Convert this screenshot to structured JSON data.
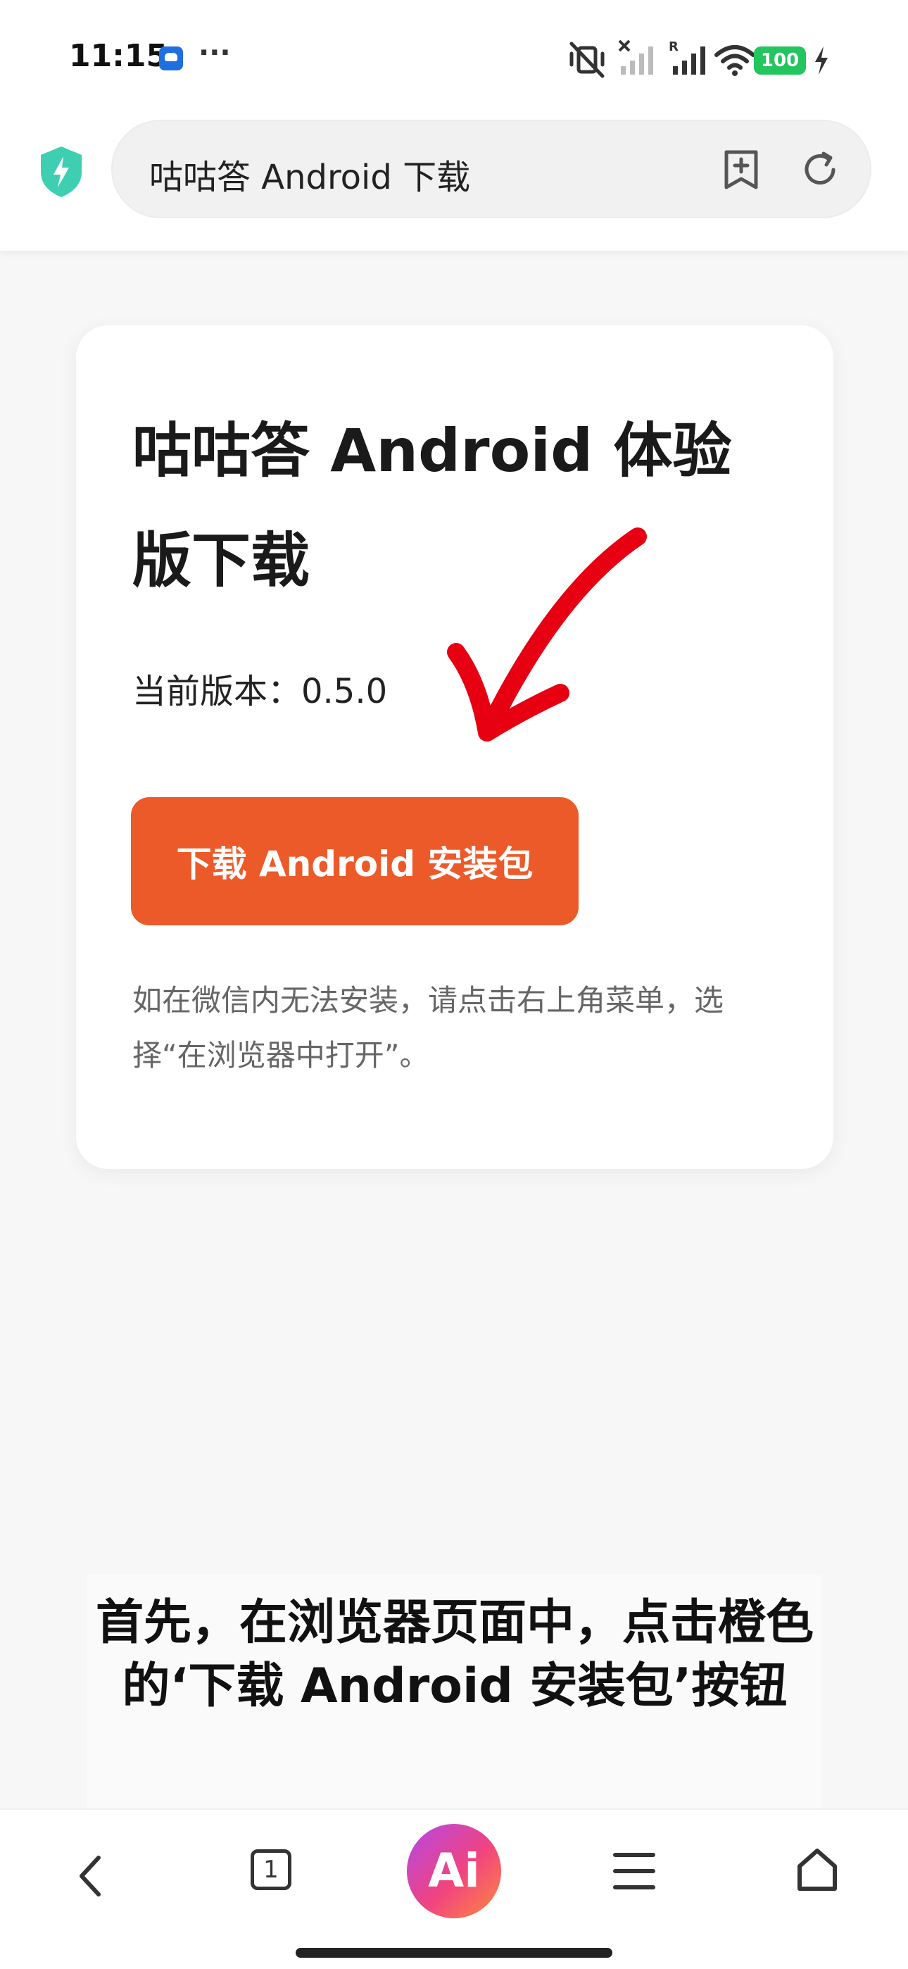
{
  "status_bar": {
    "time": "11:15",
    "more_indicator": "···",
    "battery_level": "100",
    "icons": [
      "app-notification-icon",
      "vibrate-off-icon",
      "signal-no-sim-icon",
      "signal-roaming-icon",
      "wifi-icon",
      "charging-bolt-icon"
    ]
  },
  "browser": {
    "address_text": "咕咕答 Android 下载",
    "icons": [
      "shield-lightning-icon",
      "add-bookmark-icon",
      "reload-icon"
    ],
    "colors": {
      "shield": "#3ecfb2"
    }
  },
  "card": {
    "title": "咕咕答 Android 体验版下载",
    "version_label": "当前版本：0.5.0",
    "download_button": "下载 Android 安装包",
    "note": "如在微信内无法安装，请点击右上角菜单，选择“在浏览器中打开”。",
    "colors": {
      "button": "#ed5a29",
      "annotation_arrow": "#e60012"
    }
  },
  "caption": {
    "text": "首先，在浏览器页面中，点击橙色的‘下载 Android 安装包’按钮"
  },
  "bottom_nav": {
    "tabs_count": "1",
    "ai_label": "Ai",
    "icons": [
      "back-icon",
      "tabs-icon",
      "ai-assistant-icon",
      "menu-icon",
      "home-icon"
    ]
  }
}
